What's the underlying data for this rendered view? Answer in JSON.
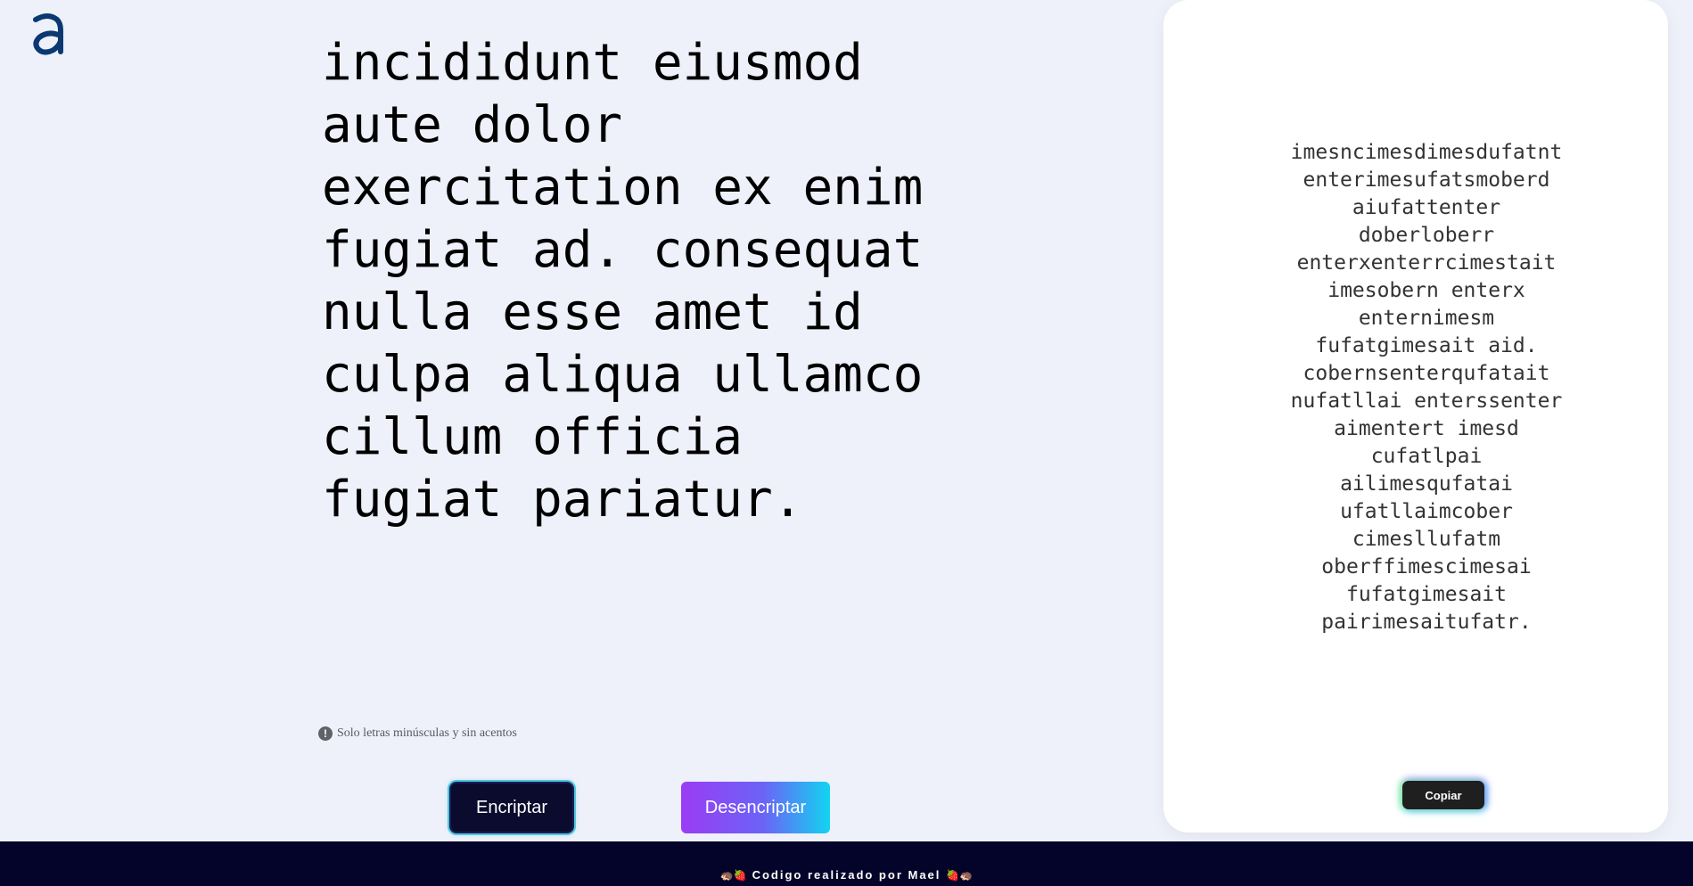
{
  "app": {
    "logo_letter": "a",
    "brand_color": "#0a3871"
  },
  "input": {
    "text": "incididunt eiusmod aute dolor exercitation ex enim fugiat ad. consequat nulla esse amet id culpa aliqua ullamco cillum officia fugiat pariatur."
  },
  "hint": {
    "icon": "exclamation-icon",
    "text": "Solo letras minúsculas y sin acentos"
  },
  "buttons": {
    "encrypt_label": "Encriptar",
    "decrypt_label": "Desencriptar",
    "copy_label": "Copiar"
  },
  "output": {
    "text": "imesncimesdimesdufatnt enterimesufatsmoberd aiufattenter doberloberr enterxenterrcimestait imesobern enterx enternimesm fufatgimesait aid. cobernsenterqufatait nufatllai enterssenter aimentert imesd cufatlpai ailimesqufatai ufatllaimcober cimesllufatm oberffimescimesai fufatgimesait pairimesaitufatr."
  },
  "footer": {
    "text": "Codigo realizado por Mael",
    "icon_left": "🦔🍓",
    "icon_right": "🍓🦔",
    "background": "#04042a"
  }
}
